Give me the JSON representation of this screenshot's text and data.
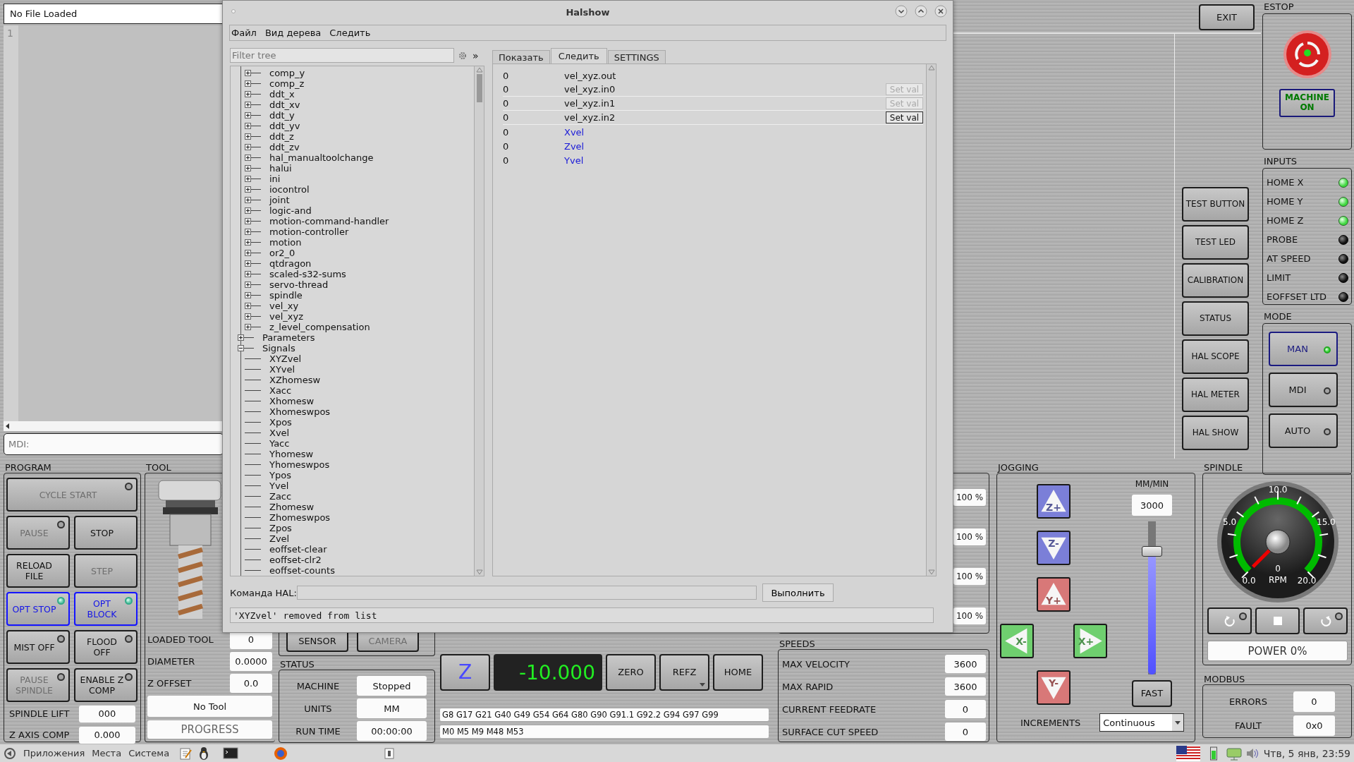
{
  "file_panel": {
    "title": "No File Loaded",
    "line_numbers": [
      "1"
    ],
    "mdi": {
      "placeholder": "MDI:"
    }
  },
  "top_bar": {
    "exit": "EXIT"
  },
  "side_buttons": [
    "TEST BUTTON",
    "TEST LED",
    "CALIBRATION",
    "STATUS",
    "HAL SCOPE",
    "HAL METER",
    "HAL SHOW"
  ],
  "estop": {
    "title": "ESTOP",
    "machine_on": {
      "label": "MACHINE ON",
      "on": true
    }
  },
  "inputs": {
    "title": "INPUTS",
    "items": [
      {
        "label": "HOME X",
        "on": true
      },
      {
        "label": "HOME Y",
        "on": true
      },
      {
        "label": "HOME Z",
        "on": true
      },
      {
        "label": "PROBE",
        "on": false
      },
      {
        "label": "AT SPEED",
        "on": false
      },
      {
        "label": "LIMIT",
        "on": false
      },
      {
        "label": "EOFFSET LTD",
        "on": false
      }
    ]
  },
  "mode": {
    "title": "MODE",
    "items": [
      {
        "label": "MAN",
        "selected": true
      },
      {
        "label": "MDI",
        "selected": false
      },
      {
        "label": "AUTO",
        "selected": false
      }
    ]
  },
  "program": {
    "title": "PROGRAM",
    "buttons": [
      {
        "label": "CYCLE START",
        "kind": "toggle",
        "checked": false,
        "disabled": true
      },
      {
        "label": "PAUSE",
        "kind": "toggle",
        "checked": false,
        "disabled": true
      },
      {
        "label": "STOP",
        "kind": "push",
        "disabled": false
      },
      {
        "label": "RELOAD FILE",
        "kind": "push",
        "disabled": false
      },
      {
        "label": "STEP",
        "kind": "push",
        "disabled": true
      },
      {
        "label": "OPT STOP",
        "kind": "toggle",
        "checked": true,
        "disabled": false
      },
      {
        "label": "OPT BLOCK",
        "kind": "toggle",
        "checked": true,
        "disabled": false
      },
      {
        "label": "MIST OFF",
        "kind": "toggle",
        "checked": false,
        "disabled": false
      },
      {
        "label": "FLOOD OFF",
        "kind": "toggle",
        "checked": false,
        "disabled": false
      },
      {
        "label": "PAUSE SPINDLE",
        "kind": "toggle",
        "checked": false,
        "disabled": true
      },
      {
        "label": "ENABLE Z COMP",
        "kind": "toggle",
        "checked": false,
        "disabled": false
      }
    ],
    "fields": [
      {
        "label": "SPINDLE LIFT",
        "value": "000"
      },
      {
        "label": "Z AXIS COMP",
        "value": "0.000"
      }
    ]
  },
  "tool": {
    "title": "TOOL",
    "fields": [
      {
        "label": "LOADED TOOL",
        "value": "0"
      },
      {
        "label": "DIAMETER",
        "value": "0.0000"
      },
      {
        "label": "Z OFFSET",
        "value": "0.0"
      }
    ],
    "tool_name": "No Tool",
    "progress": {
      "label": "PROGRESS",
      "level": 0
    }
  },
  "probe_buttons": [
    {
      "label": "SENSOR",
      "disabled": false
    },
    {
      "label": "CAMERA",
      "disabled": true
    }
  ],
  "status": {
    "title": "STATUS",
    "rows": [
      {
        "label": "MACHINE",
        "value": "Stopped"
      },
      {
        "label": "UNITS",
        "value": "MM"
      },
      {
        "label": "RUN TIME",
        "value": "00:00:00"
      }
    ]
  },
  "dro": {
    "axis": "Z",
    "value": "-10.000",
    "buttons": [
      {
        "label": "ZERO",
        "menu": false
      },
      {
        "label": "REFZ",
        "menu": true
      },
      {
        "label": "HOME",
        "menu": false
      }
    ]
  },
  "active_gcodes": "G8 G17 G21 G40 G49 G54 G64 G80 G90 G91.1 G92.2 G94 G97 G99",
  "active_mcodes": "M0 M5 M9 M48 M53",
  "overrides": [
    "100 %",
    "100 %",
    "100 %",
    "100 %"
  ],
  "speeds": {
    "title": "SPEEDS",
    "rows": [
      {
        "label": "MAX VELOCITY",
        "value": "3600"
      },
      {
        "label": "MAX RAPID",
        "value": "3600"
      },
      {
        "label": "CURRENT FEEDRATE",
        "value": "0"
      },
      {
        "label": "SURFACE CUT SPEED",
        "value": "0"
      }
    ]
  },
  "jogging": {
    "title": "JOGGING",
    "buttons": [
      {
        "label": "Z+",
        "kind": "up",
        "color": "#7b7fd8"
      },
      {
        "label": "Z-",
        "kind": "down",
        "color": "#7b7fd8"
      },
      {
        "label": "Y+",
        "kind": "up",
        "color": "#d87878"
      },
      {
        "label": "X-",
        "kind": "left",
        "color": "#6fcf6f"
      },
      {
        "label": "X+",
        "kind": "right",
        "color": "#6fcf6f"
      },
      {
        "label": "Y-",
        "kind": "down",
        "color": "#d87878"
      }
    ],
    "rate_unit": "MM/MIN",
    "rate": "3000",
    "slider": {
      "level": 0.8
    },
    "fast": "FAST",
    "increments": {
      "label": "INCREMENTS",
      "value": "Continuous"
    }
  },
  "spindle": {
    "title": "SPINDLE",
    "gauge": {
      "ticks": [
        "0.0",
        "5.0",
        "10.0",
        "15.0",
        "20.0"
      ],
      "reading": "0",
      "unit": "RPM"
    },
    "buttons": [
      {
        "kind": "reverse",
        "on": false
      },
      {
        "kind": "stop"
      },
      {
        "kind": "forward",
        "on": false
      }
    ],
    "power": "POWER 0%"
  },
  "modbus": {
    "title": "MODBUS",
    "rows": [
      {
        "label": "ERRORS",
        "value": "0"
      },
      {
        "label": "FAULT",
        "value": "0x0"
      }
    ]
  },
  "halshow": {
    "title": "Halshow",
    "menu": [
      "Файл",
      "Вид дерева",
      "Следить"
    ],
    "filter": {
      "placeholder": "Filter tree"
    },
    "expand_button": "»",
    "tabs": [
      {
        "label": "Показать",
        "selected": false
      },
      {
        "label": "Следить",
        "selected": true
      },
      {
        "label": "SETTINGS",
        "selected": false
      }
    ],
    "tree": [
      {
        "children": [
          {
            "label": "comp_y",
            "expanded": false
          },
          {
            "label": "comp_z",
            "expanded": false
          },
          {
            "label": "ddt_x",
            "expanded": false
          },
          {
            "label": "ddt_xv",
            "expanded": false
          },
          {
            "label": "ddt_y",
            "expanded": false
          },
          {
            "label": "ddt_yv",
            "expanded": false
          },
          {
            "label": "ddt_z",
            "expanded": false
          },
          {
            "label": "ddt_zv",
            "expanded": false
          },
          {
            "label": "hal_manualtoolchange",
            "expanded": false
          },
          {
            "label": "halui",
            "expanded": false
          },
          {
            "label": "ini",
            "expanded": false
          },
          {
            "label": "iocontrol",
            "expanded": false
          },
          {
            "label": "joint",
            "expanded": false
          },
          {
            "label": "logic-and",
            "expanded": false
          },
          {
            "label": "motion-command-handler",
            "expanded": false
          },
          {
            "label": "motion-controller",
            "expanded": false
          },
          {
            "label": "motion",
            "expanded": false
          },
          {
            "label": "or2_0",
            "expanded": false
          },
          {
            "label": "qtdragon",
            "expanded": false
          },
          {
            "label": "scaled-s32-sums",
            "expanded": false
          },
          {
            "label": "servo-thread",
            "expanded": false
          },
          {
            "label": "spindle",
            "expanded": false
          },
          {
            "label": "vel_xy",
            "expanded": false
          },
          {
            "label": "vel_xyz",
            "expanded": false
          },
          {
            "label": "z_level_compensation",
            "expanded": false
          }
        ]
      },
      {
        "label": "Parameters",
        "expanded": false
      },
      {
        "label": "Signals",
        "expanded": true,
        "children": [
          {
            "label": "XYZvel"
          },
          {
            "label": "XYvel"
          },
          {
            "label": "XZhomesw"
          },
          {
            "label": "Xacc"
          },
          {
            "label": "Xhomesw"
          },
          {
            "label": "Xhomeswpos"
          },
          {
            "label": "Xpos"
          },
          {
            "label": "Xvel"
          },
          {
            "label": "Yacc"
          },
          {
            "label": "Yhomesw"
          },
          {
            "label": "Yhomeswpos"
          },
          {
            "label": "Ypos"
          },
          {
            "label": "Yvel"
          },
          {
            "label": "Zacc"
          },
          {
            "label": "Zhomesw"
          },
          {
            "label": "Zhomeswpos"
          },
          {
            "label": "Zpos"
          },
          {
            "label": "Zvel"
          },
          {
            "label": "eoffset-clear"
          },
          {
            "label": "eoffset-clr2"
          },
          {
            "label": "eoffset-counts"
          }
        ]
      }
    ],
    "watch": [
      {
        "value": "0",
        "name": "vel_xyz.out",
        "kind": "pin"
      },
      {
        "value": "0",
        "name": "vel_xyz.in0",
        "kind": "pin",
        "button": "Set val",
        "disabled": true
      },
      {
        "value": "0",
        "name": "vel_xyz.in1",
        "kind": "pin",
        "button": "Set val",
        "disabled": true
      },
      {
        "value": "0",
        "name": "vel_xyz.in2",
        "kind": "pin",
        "button": "Set val",
        "disabled": false
      },
      {
        "value": "0",
        "name": "Xvel",
        "kind": "signal"
      },
      {
        "value": "0",
        "name": "Zvel",
        "kind": "signal"
      },
      {
        "value": "0",
        "name": "Yvel",
        "kind": "signal"
      }
    ],
    "command": {
      "label": "Команда HAL:",
      "button": "Выполнить"
    },
    "message": "'XYZvel' removed from list"
  },
  "taskbar": {
    "menus": [
      "Приложения",
      "Места",
      "Система"
    ],
    "clock": "Чтв, 5 янв, 23:59"
  }
}
